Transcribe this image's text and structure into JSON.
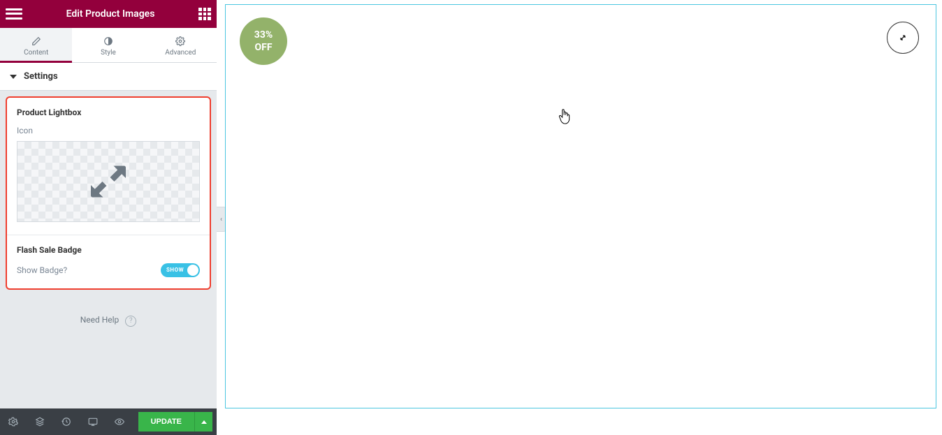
{
  "header": {
    "title": "Edit Product Images"
  },
  "tabs": {
    "content": "Content",
    "style": "Style",
    "advanced": "Advanced"
  },
  "section": {
    "settings": "Settings"
  },
  "lightbox": {
    "group": "Product Lightbox",
    "icon_label": "Icon"
  },
  "flash": {
    "group": "Flash Sale Badge",
    "show_label": "Show Badge?",
    "toggle_text": "SHOW"
  },
  "help": {
    "label": "Need Help"
  },
  "footer": {
    "update": "UPDATE"
  },
  "preview": {
    "badge_line1": "33%",
    "badge_line2": "OFF"
  }
}
